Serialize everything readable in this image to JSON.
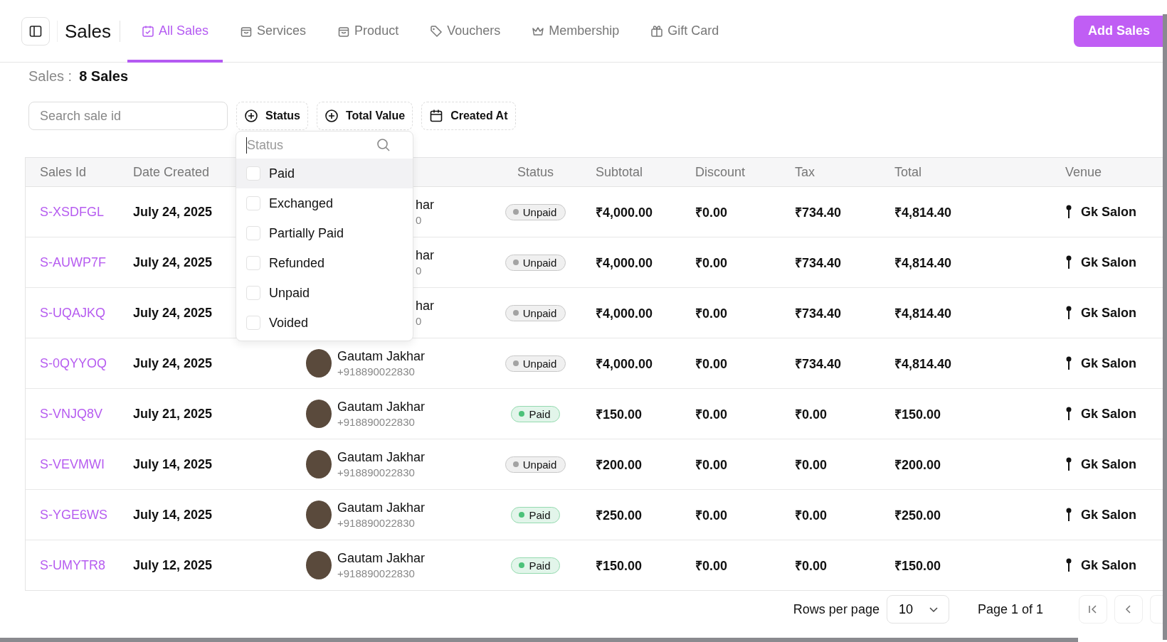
{
  "header": {
    "title": "Sales",
    "tabs": [
      {
        "label": "All Sales",
        "selected": true
      },
      {
        "label": "Services",
        "selected": false
      },
      {
        "label": "Product",
        "selected": false
      },
      {
        "label": "Vouchers",
        "selected": false
      },
      {
        "label": "Membership",
        "selected": false
      },
      {
        "label": "Gift Card",
        "selected": false
      }
    ],
    "action": "Add Sales"
  },
  "summary": {
    "label": "Sales :",
    "value": "8 Sales"
  },
  "filters": {
    "search": {
      "placeholder": "Search sale id"
    },
    "chips": [
      {
        "label": "Status"
      },
      {
        "label": "Total Value"
      },
      {
        "label": "Created At"
      }
    ]
  },
  "status_dropdown": {
    "placeholder": "Status",
    "options": [
      {
        "label": "Paid",
        "checked": false,
        "selected": true
      },
      {
        "label": "Exchanged",
        "checked": false,
        "selected": false
      },
      {
        "label": "Partially Paid",
        "checked": false,
        "selected": false
      },
      {
        "label": "Refunded",
        "checked": false,
        "selected": false
      },
      {
        "label": "Unpaid",
        "checked": false,
        "selected": false
      },
      {
        "label": "Voided",
        "checked": false,
        "selected": false
      }
    ]
  },
  "table": {
    "columns": [
      "Sales Id",
      "Date Created",
      "Status",
      "Subtotal",
      "Discount",
      "Tax",
      "Total",
      "Venue"
    ],
    "rows": [
      {
        "id": "S-XSDFGL",
        "date": "July 24, 2025",
        "customer": {
          "name": "har",
          "phone": "0",
          "kind": "partial"
        },
        "status": {
          "label": "Unpaid",
          "color": "#a3a3a3"
        },
        "subtotal": "₹4,000.00",
        "discount": "₹0.00",
        "tax": "₹734.40",
        "total": "₹4,814.40",
        "venue": "Gk Salon"
      },
      {
        "id": "S-AUWP7F",
        "date": "July 24, 2025",
        "customer": {
          "name": "har",
          "phone": "0",
          "kind": "partial"
        },
        "status": {
          "label": "Unpaid",
          "color": "#a3a3a3"
        },
        "subtotal": "₹4,000.00",
        "discount": "₹0.00",
        "tax": "₹734.40",
        "total": "₹4,814.40",
        "venue": "Gk Salon"
      },
      {
        "id": "S-UQAJKQ",
        "date": "July 24, 2025",
        "customer": {
          "name": "har",
          "phone": "0",
          "kind": "partial"
        },
        "status": {
          "label": "Unpaid",
          "color": "#a3a3a3"
        },
        "subtotal": "₹4,000.00",
        "discount": "₹0.00",
        "tax": "₹734.40",
        "total": "₹4,814.40",
        "venue": "Gk Salon"
      },
      {
        "id": "S-0QYYOQ",
        "date": "July 24, 2025",
        "customer": {
          "name": "Gautam Jakhar",
          "phone": "+918890022830",
          "kind": "full"
        },
        "status": {
          "label": "Unpaid",
          "color": "#a3a3a3"
        },
        "subtotal": "₹4,000.00",
        "discount": "₹0.00",
        "tax": "₹734.40",
        "total": "₹4,814.40",
        "venue": "Gk Salon"
      },
      {
        "id": "S-VNJQ8V",
        "date": "July 21, 2025",
        "customer": {
          "name": "Gautam Jakhar",
          "phone": "+918890022830",
          "kind": "full"
        },
        "status": {
          "label": "Paid",
          "color": "#4cc27a"
        },
        "subtotal": "₹150.00",
        "discount": "₹0.00",
        "tax": "₹0.00",
        "total": "₹150.00",
        "venue": "Gk Salon"
      },
      {
        "id": "S-VEVMWI",
        "date": "July 14, 2025",
        "customer": {
          "name": "Gautam Jakhar",
          "phone": "+918890022830",
          "kind": "full"
        },
        "status": {
          "label": "Unpaid",
          "color": "#a3a3a3"
        },
        "subtotal": "₹200.00",
        "discount": "₹0.00",
        "tax": "₹0.00",
        "total": "₹200.00",
        "venue": "Gk Salon"
      },
      {
        "id": "S-YGE6WS",
        "date": "July 14, 2025",
        "customer": {
          "name": "Gautam Jakhar",
          "phone": "+918890022830",
          "kind": "full"
        },
        "status": {
          "label": "Paid",
          "color": "#4cc27a"
        },
        "subtotal": "₹250.00",
        "discount": "₹0.00",
        "tax": "₹0.00",
        "total": "₹250.00",
        "venue": "Gk Salon"
      },
      {
        "id": "S-UMYTR8",
        "date": "July 12, 2025",
        "customer": {
          "name": "Gautam Jakhar",
          "phone": "+918890022830",
          "kind": "full"
        },
        "status": {
          "label": "Paid",
          "color": "#4cc27a"
        },
        "subtotal": "₹150.00",
        "discount": "₹0.00",
        "tax": "₹0.00",
        "total": "₹150.00",
        "venue": "Gk Salon"
      }
    ]
  },
  "pagination": {
    "rows_label": "Rows per page",
    "rows_value": "10",
    "page": "Page 1 of 1"
  }
}
